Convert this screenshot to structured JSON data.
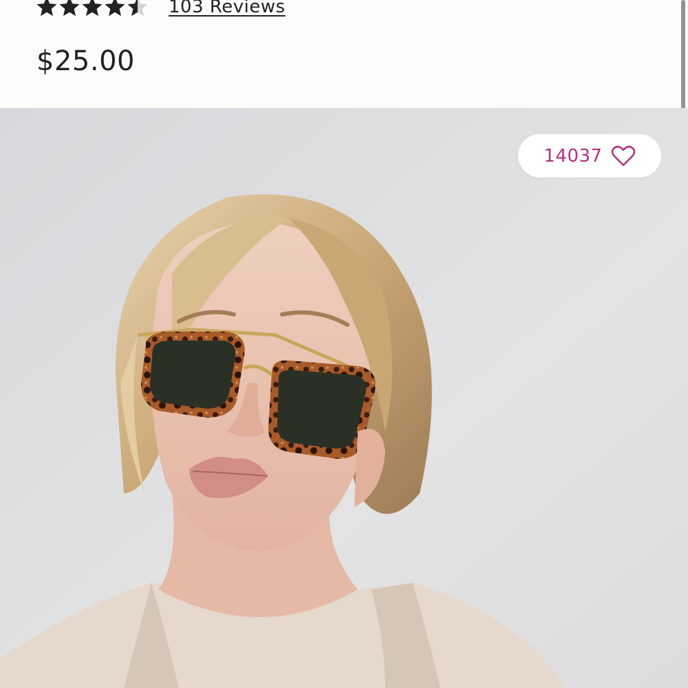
{
  "product": {
    "rating": 4.5,
    "rating_max": 5,
    "reviews_label": "103 Reviews",
    "price": "$25.00"
  },
  "favorite": {
    "count": "14037",
    "icon": "heart-outline-icon"
  },
  "photo": {
    "subject": "product-photo"
  },
  "colors": {
    "accent": "#b0337c",
    "text": "#222222",
    "panel_background": "#fdfbfa",
    "photo_background": "#dedfe1"
  }
}
